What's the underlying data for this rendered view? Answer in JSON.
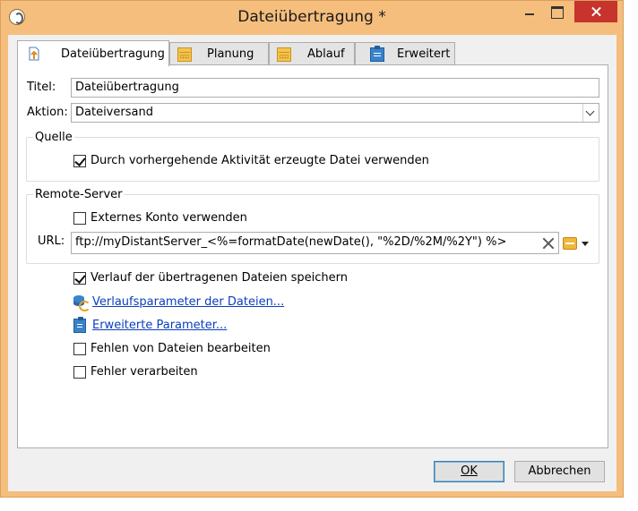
{
  "window": {
    "title": "Dateiübertragung *",
    "icons": {
      "app": "app-icon",
      "minimize": "minimize-icon",
      "maximize": "maximize-icon",
      "close": "close-icon"
    }
  },
  "tabs": [
    {
      "label": "Dateiübertragung",
      "icon": "upload-file-icon",
      "active": true
    },
    {
      "label": "Planung",
      "icon": "calendar-icon",
      "active": false
    },
    {
      "label": "Ablauf",
      "icon": "calendar-icon",
      "active": false
    },
    {
      "label": "Erweitert",
      "icon": "clipboard-icon",
      "active": false
    }
  ],
  "form": {
    "titel_label": "Titel:",
    "titel_value": "Dateiübertragung",
    "aktion_label": "Aktion:",
    "aktion_value": "Dateiversand"
  },
  "quelle": {
    "legend": "Quelle",
    "checkbox_label": "Durch vorhergehende Aktivität erzeugte Datei verwenden",
    "checked": true
  },
  "remote": {
    "legend": "Remote-Server",
    "external_label": "Externes Konto verwenden",
    "external_checked": false,
    "url_label": "URL:",
    "url_value": "ftp://myDistantServer_<%=formatDate(newDate(), \"%2D/%2M/%2Y\") %>"
  },
  "options": {
    "history_label": "Verlauf der übertragenen Dateien speichern",
    "history_checked": true,
    "history_params_link": "Verlaufsparameter der Dateien...",
    "advanced_params_link": "Erweiterte Parameter...",
    "missing_files_label": "Fehlen von Dateien bearbeiten",
    "missing_files_checked": false,
    "errors_label": "Fehler verarbeiten",
    "errors_checked": false
  },
  "buttons": {
    "ok": "OK",
    "cancel": "Abbrechen"
  },
  "colors": {
    "frame": "#f5be7c",
    "close_button": "#c7332d",
    "link": "#0b3ebd"
  }
}
